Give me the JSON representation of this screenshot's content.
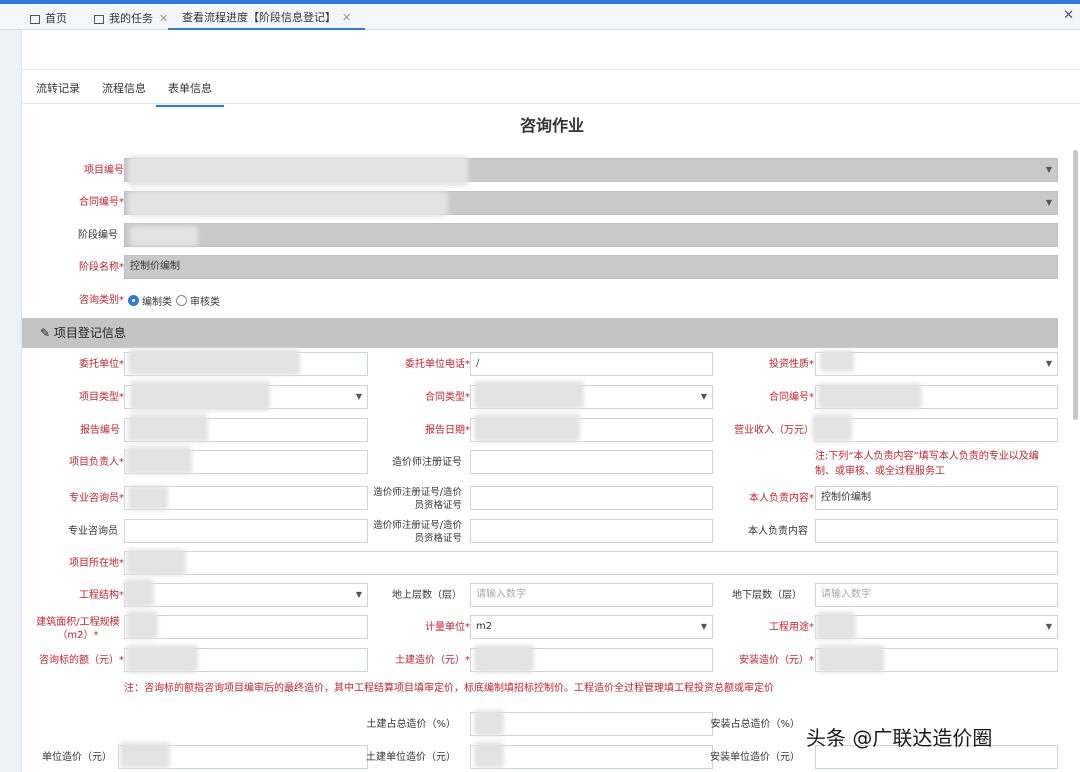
{
  "window_tabs": [
    {
      "label": "首页"
    },
    {
      "label": "我的任务"
    },
    {
      "label": "查看流程进度【阶段信息登记】"
    }
  ],
  "sub_tabs": [
    "流转记录",
    "流程信息",
    "表单信息"
  ],
  "form_title": "咨询作业",
  "basic": {
    "project_no_label": "项目编号",
    "contract_no_label": "合同编号*",
    "stage_no_label": "阶段编号",
    "stage_name_label": "阶段名称*",
    "stage_name_value": "控制价编制",
    "consult_type_label": "咨询类别*",
    "consult_type_options": [
      "编制类",
      "审核类"
    ]
  },
  "section_title": "项目登记信息",
  "fields": {
    "client_unit": "委托单位*",
    "client_phone": "委托单位电话*",
    "client_phone_value": "/",
    "invest_nature": "投资性质*",
    "project_type": "项目类型*",
    "contract_type": "合同类型*",
    "contract_no2": "合同编号*",
    "report_no": "报告编号",
    "report_date": "报告日期*",
    "revenue": "营业收入（万元）",
    "project_leader": "项目负责人*",
    "cost_engineer_cert": "造价师注册证号",
    "note_top": "注:下列“本人负责内容”填写本人负责的专业以及编制、或审核、或全过程服务工",
    "consultant1": "专业咨询员*",
    "cert_combo1": "造价师注册证号/造价员资格证号",
    "my_content1": "本人负责内容*",
    "my_content1_value": "控制价编制",
    "consultant2": "专业咨询员",
    "cert_combo2": "造价师注册证号/造价员资格证号",
    "my_content2": "本人负责内容",
    "project_location": "项目所在地*",
    "structure": "工程结构*",
    "floors_above": "地上层数（层）",
    "floors_above_ph": "请输入数字",
    "floors_below": "地下层数（层）",
    "floors_below_ph": "请输入数字",
    "area": "建筑面积/工程规模（m2）*",
    "unit": "计量单位*",
    "unit_value": "m2",
    "usage": "工程用途*",
    "consult_amount": "咨询标的额（元）*",
    "civil_cost": "土建造价（元）*",
    "install_cost": "安装造价（元）*",
    "note_bottom": "注：咨询标的额指咨询项目编审后的最终造价，其中工程结算项目填审定价，标底编制填招标控制价。工程造价全过程管理填工程投资总额或审定价",
    "civil_pct": "土建占总造价（%）",
    "install_pct": "安装占总造价（%）",
    "unit_cost": "单位造价（元）",
    "civil_unit_cost": "土建单位造价（元）",
    "install_unit_cost": "安装单位造价（元）"
  },
  "watermark": "头条 @广联达造价圈"
}
